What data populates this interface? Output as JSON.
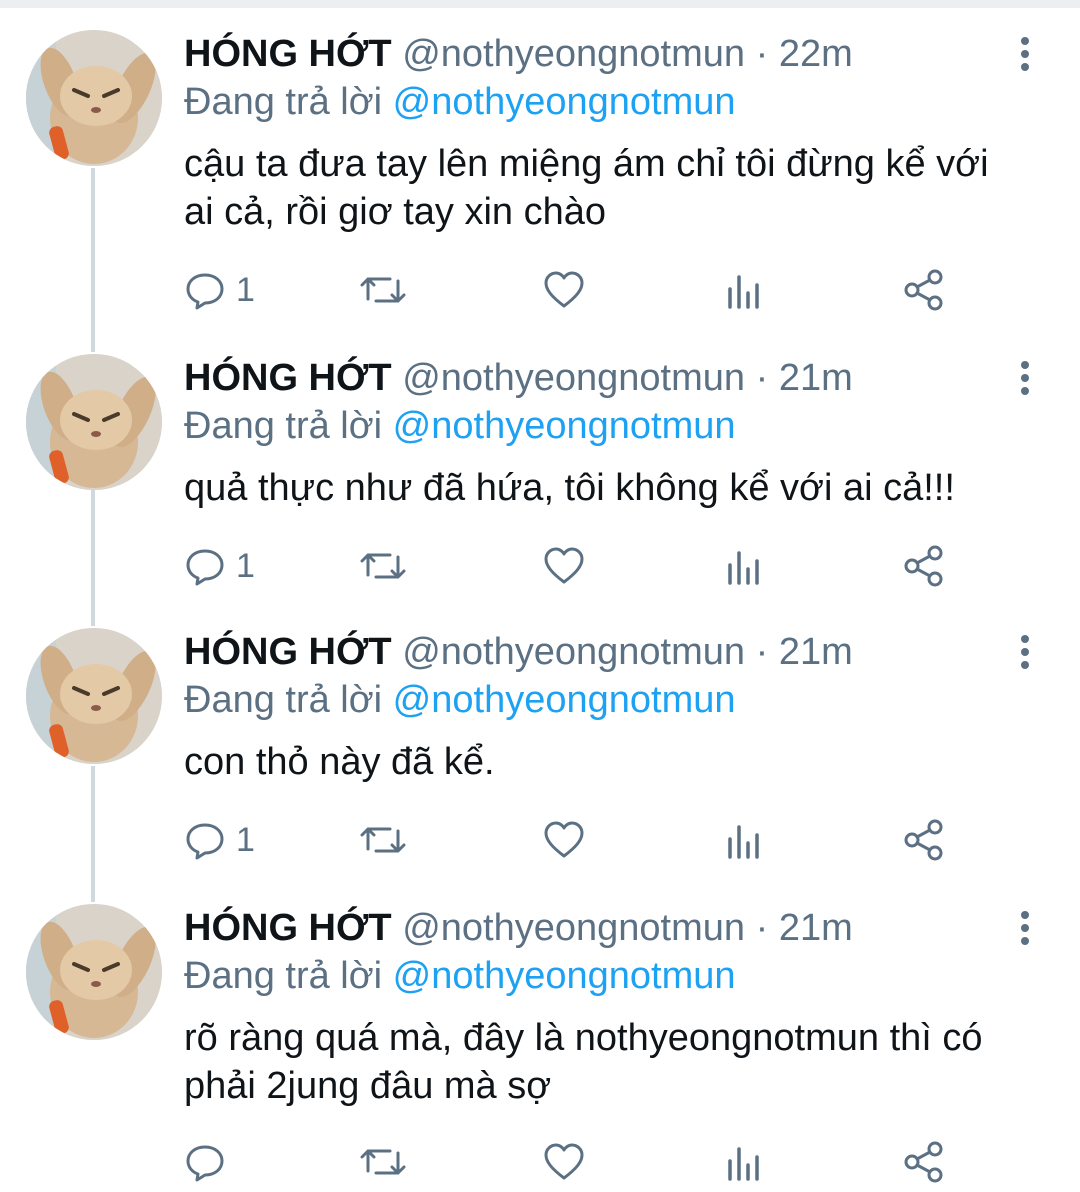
{
  "tweets": [
    {
      "name": "HÓNG HỚT",
      "handle": "@nothyeongnotmun",
      "separator": "·",
      "time": "22m",
      "reply_prefix": "Đang trả lời",
      "reply_to": "@nothyeongnotmun",
      "text": "cậu ta đưa tay lên miệng ám chỉ tôi đừng kể với\nai cả, rồi giơ tay xin chào",
      "reply_count": "1"
    },
    {
      "name": "HÓNG HỚT",
      "handle": "@nothyeongnotmun",
      "separator": "·",
      "time": "21m",
      "reply_prefix": "Đang trả lời",
      "reply_to": "@nothyeongnotmun",
      "text": "quả thực như đã hứa, tôi không kể với ai cả!!!",
      "reply_count": "1"
    },
    {
      "name": "HÓNG HỚT",
      "handle": "@nothyeongnotmun",
      "separator": "·",
      "time": "21m",
      "reply_prefix": "Đang trả lời",
      "reply_to": "@nothyeongnotmun",
      "text": "con thỏ này đã kể.",
      "reply_count": "1"
    },
    {
      "name": "HÓNG HỚT",
      "handle": "@nothyeongnotmun",
      "separator": "·",
      "time": "21m",
      "reply_prefix": "Đang trả lời",
      "reply_to": "@nothyeongnotmun",
      "text": "rõ ràng quá mà, đây là nothyeongnotmun thì có\nphải 2jung đâu mà sợ",
      "reply_count": ""
    }
  ],
  "icons": {
    "reply": "reply-icon",
    "retweet": "retweet-icon",
    "like": "heart-icon",
    "analytics": "analytics-icon",
    "share": "share-icon",
    "more": "more-vertical-icon"
  },
  "colors": {
    "accent": "#1da1f2",
    "muted": "#5b7083",
    "text": "#0f1419",
    "thread_line": "#cfd9de"
  }
}
